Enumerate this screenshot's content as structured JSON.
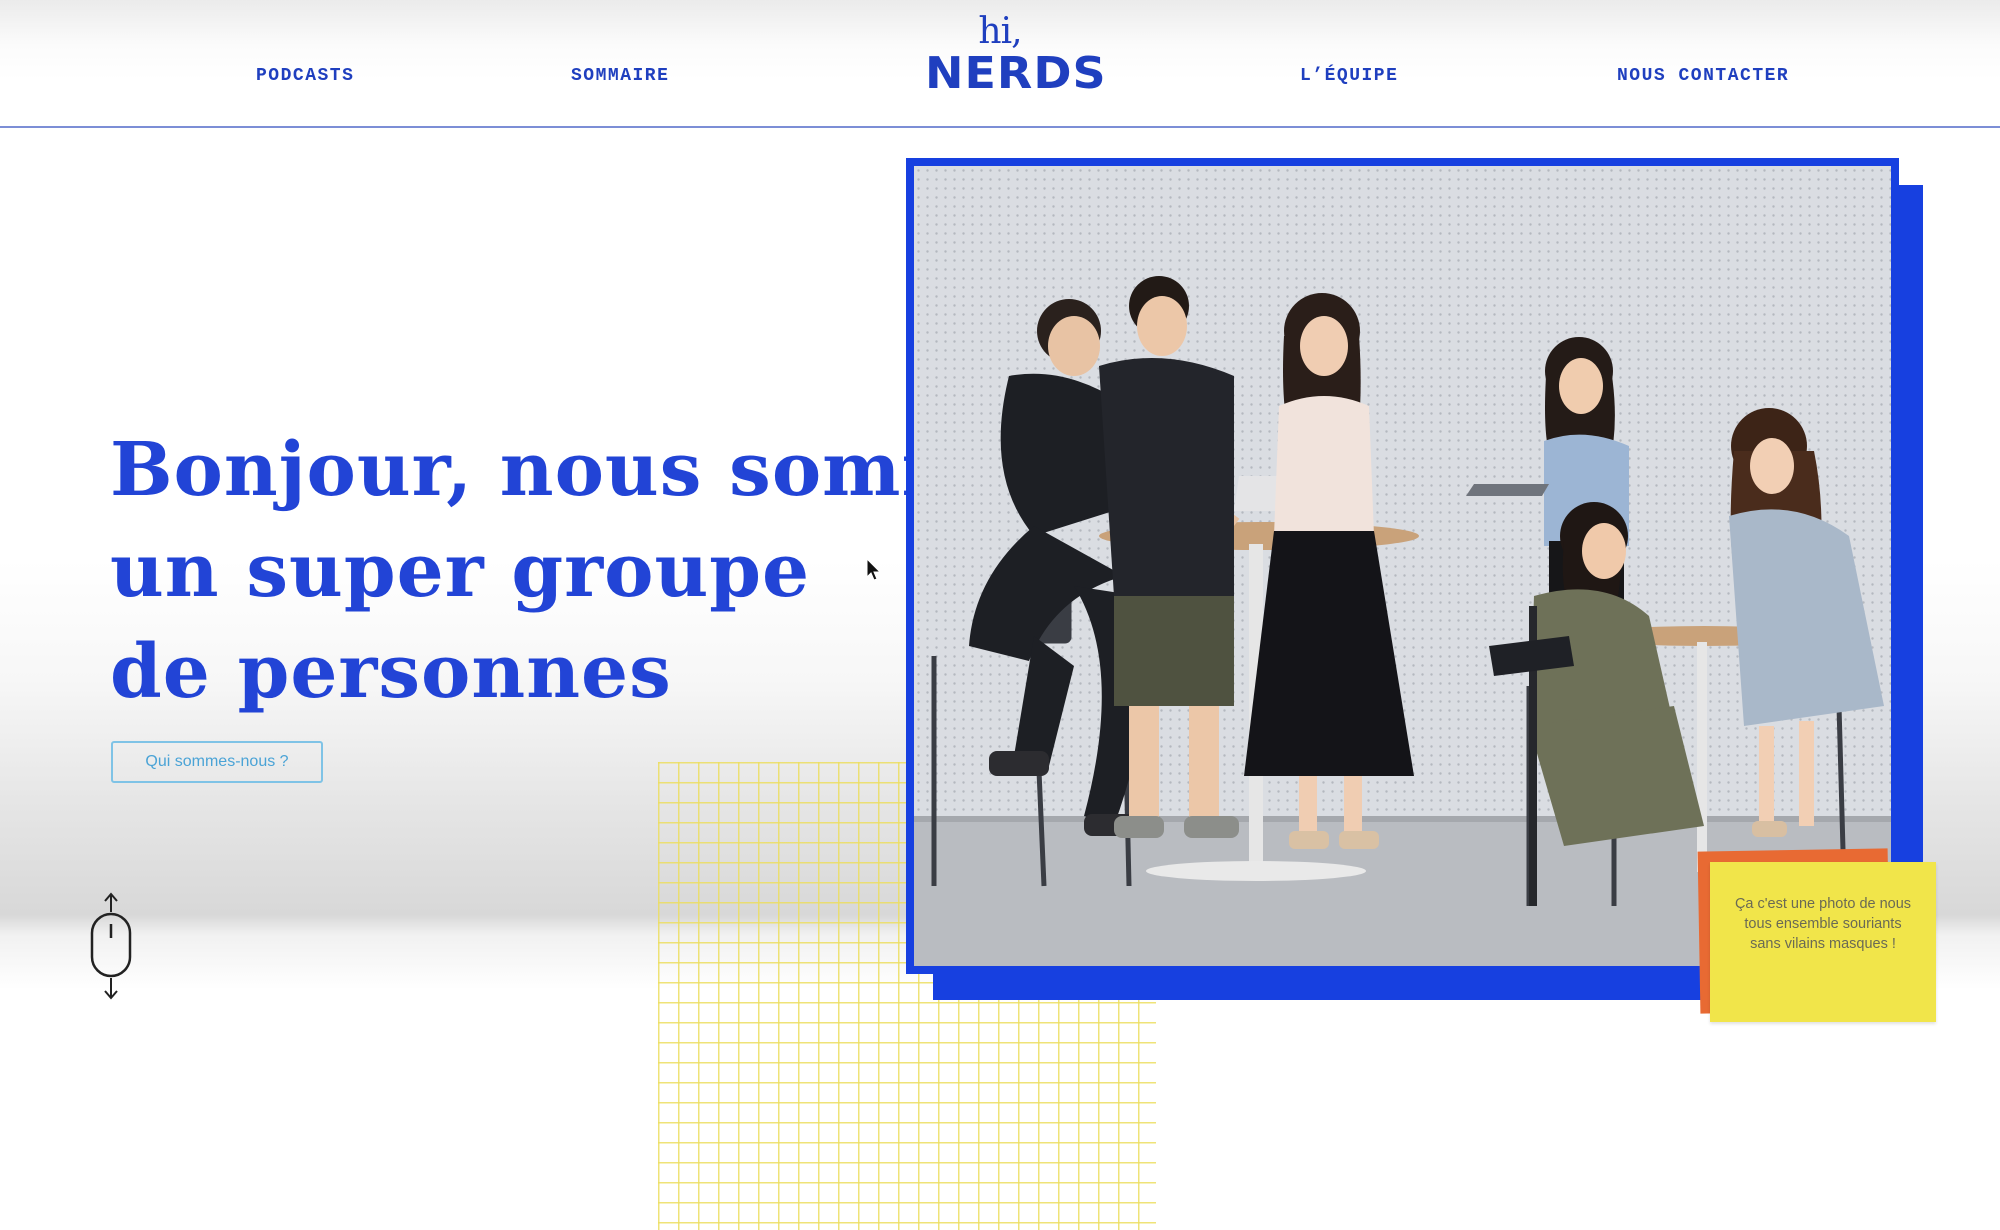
{
  "nav": {
    "podcasts": "PODCASTS",
    "sommaire": "SOMMAIRE",
    "equipe": "L’ÉQUIPE",
    "contact": "NOUS CONTACTER"
  },
  "logo": {
    "hi": "hi,",
    "nerds": "NERDS"
  },
  "hero": {
    "headline_lines": [
      "Bonjour, nous sommes",
      "un super groupe",
      "de personnes"
    ],
    "cta_label": "Qui sommes-nous ?"
  },
  "photo": {
    "caption_note": "Ça c'est une photo de nous tous ensemble souriants sans vilains masques !"
  },
  "colors": {
    "brand_blue": "#1740e0",
    "headline_blue": "#2244d6",
    "note_yellow": "#f1e54a",
    "note_orange": "#e86a33",
    "grid_yellow": "#ecde60",
    "button_border": "#7fc3e6"
  },
  "icons": {
    "scroll": "mouse-scroll-icon",
    "cursor": "mouse-pointer-icon"
  }
}
